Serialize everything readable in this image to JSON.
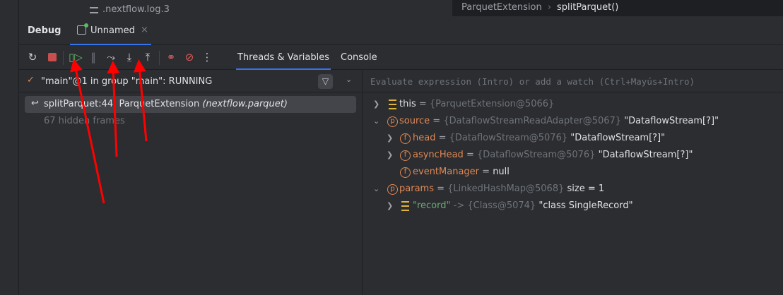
{
  "top": {
    "file_item": ".nextflow.log.3",
    "breadcrumb": [
      "ParquetExtension",
      "splitParquet()"
    ]
  },
  "debug": {
    "title": "Debug",
    "session_tab": "Unnamed",
    "close": "×"
  },
  "toolbar": {
    "buttons": [
      "rerun-icon",
      "stop-icon",
      "resume-icon",
      "pause-icon",
      "step-over-icon",
      "step-into-icon",
      "step-out-icon",
      "view-breakpoints-icon",
      "mute-breakpoints-icon",
      "more-icon"
    ],
    "tabs": [
      "Threads & Variables",
      "Console"
    ],
    "active_tab": "Threads & Variables"
  },
  "thread": {
    "label": "\"main\"@1 in group \"main\": RUNNING"
  },
  "frames": {
    "current": "splitParquet:44, ParquetExtension ",
    "package": "(nextflow.parquet)",
    "hidden": "67 hidden frames"
  },
  "evaluate": {
    "placeholder": "Evaluate expression (Intro) or add a watch (Ctrl+Mayús+Intro)"
  },
  "variables": [
    {
      "name": "this",
      "eq": " = ",
      "type": "{ParquetExtension@5066}",
      "value": ""
    },
    {
      "name": "source",
      "eq": " = ",
      "type": "{DataflowStreamReadAdapter@5067}",
      "value": " \"DataflowStream[?]\""
    },
    {
      "name": "head",
      "eq": " = ",
      "type": "{DataflowStream@5076}",
      "value": " \"DataflowStream[?]\""
    },
    {
      "name": "asyncHead",
      "eq": " = ",
      "type": "{DataflowStream@5076}",
      "value": " \"DataflowStream[?]\""
    },
    {
      "name": "eventManager",
      "eq": " = ",
      "type": "",
      "value": "null"
    },
    {
      "name": "params",
      "eq": " = ",
      "type": "{LinkedHashMap@5068}",
      "value": "  size = 1"
    },
    {
      "name": "\"record\"",
      "eq": " -> ",
      "type": "{Class@5074}",
      "value": " \"class SingleRecord\""
    }
  ],
  "colors": {
    "accent": "#3574f0",
    "annotation_arrow": "#ff0000"
  }
}
